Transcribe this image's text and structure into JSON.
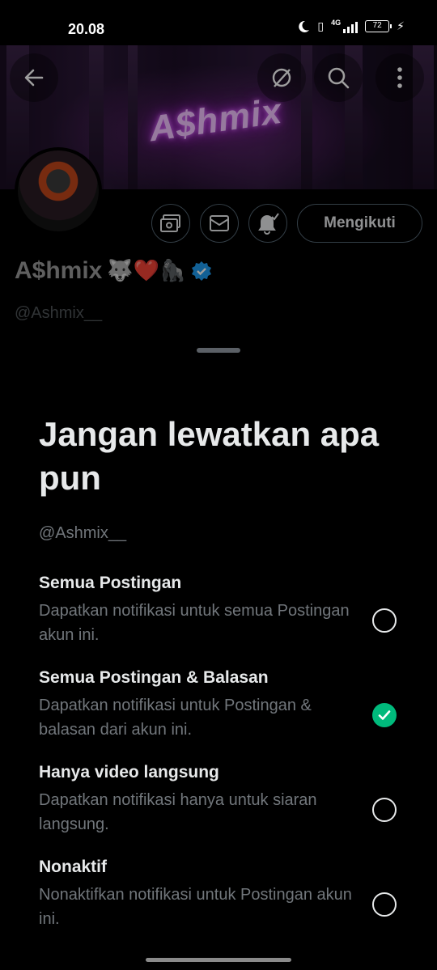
{
  "status_bar": {
    "time": "20.08",
    "network": "4G",
    "battery": "72"
  },
  "banner": {
    "logo_text": "A$hmix"
  },
  "profile": {
    "name": "A$hmix",
    "name_emojis": "🐺❤️🦍",
    "handle": "@Ashmix__",
    "bio": "'",
    "follow_button_label": "Mengikuti"
  },
  "sheet": {
    "title": "Jangan lewatkan apa pun",
    "handle": "@Ashmix__",
    "options": [
      {
        "title": "Semua Postingan",
        "description": "Dapatkan notifikasi untuk semua Postingan akun ini.",
        "selected": false
      },
      {
        "title": "Semua Postingan & Balasan",
        "description": "Dapatkan notifikasi untuk Postingan & balasan dari akun ini.",
        "selected": true
      },
      {
        "title": "Hanya video langsung",
        "description": "Dapatkan notifikasi hanya untuk siaran langsung.",
        "selected": false
      },
      {
        "title": "Nonaktif",
        "description": "Nonaktifkan notifikasi untuk Postingan akun ini.",
        "selected": false
      }
    ]
  },
  "colors": {
    "background": "#000000",
    "text_primary": "#e7e9ea",
    "text_secondary": "#71767b",
    "selected_green": "#00ba7c",
    "verified_blue": "#1d9bf0"
  },
  "icons": [
    "back-arrow-icon",
    "grok-icon",
    "search-icon",
    "more-icon",
    "subscribe-icon",
    "message-icon",
    "bell-check-icon",
    "verified-icon",
    "check-icon"
  ]
}
